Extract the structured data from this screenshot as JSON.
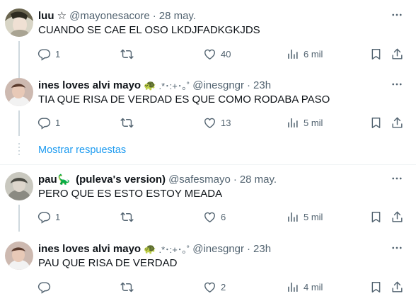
{
  "tweets": [
    {
      "name": "luu ☆",
      "handle": "@mayonesacore",
      "time": "28 may.",
      "text": "CUANDO SE CAE EL OSO LKDJFADKGKJDS",
      "replies": "1",
      "retweets": "",
      "likes": "40",
      "views": "6 mil"
    },
    {
      "name": "ines loves alvi mayo",
      "emoji": "🐢",
      "sparkle": ".*･:+･｡˚",
      "handle": "@inesgngr",
      "time": "23h",
      "text": "TIA QUE RISA DE VERDAD ES QUE COMO RODABA PASO",
      "replies": "1",
      "retweets": "",
      "likes": "13",
      "views": "5 mil"
    },
    {
      "name": "pau",
      "emoji": "🦕",
      "name_suffix": "(puleva's version)",
      "handle": "@safesmayo",
      "time": "28 may.",
      "text": "PERO QUE ES ESTO ESTOY MEADA",
      "replies": "1",
      "retweets": "",
      "likes": "6",
      "views": "5 mil"
    },
    {
      "name": "ines loves alvi mayo",
      "emoji": "🐢",
      "sparkle": ".*･:+･｡˚",
      "handle": "@inesgngr",
      "time": "23h",
      "text": "PAU QUE RISA DE VERDAD",
      "replies": "",
      "retweets": "",
      "likes": "2",
      "views": "4 mil"
    }
  ],
  "show_replies_label": "Mostrar respuestas",
  "separator": "·",
  "colors": {
    "accent": "#1d9bf0",
    "text_secondary": "#536471",
    "thread_line": "#cfd9de"
  },
  "icons": [
    "reply-icon",
    "retweet-icon",
    "like-icon",
    "views-icon",
    "bookmark-icon",
    "share-icon",
    "more-icon"
  ]
}
